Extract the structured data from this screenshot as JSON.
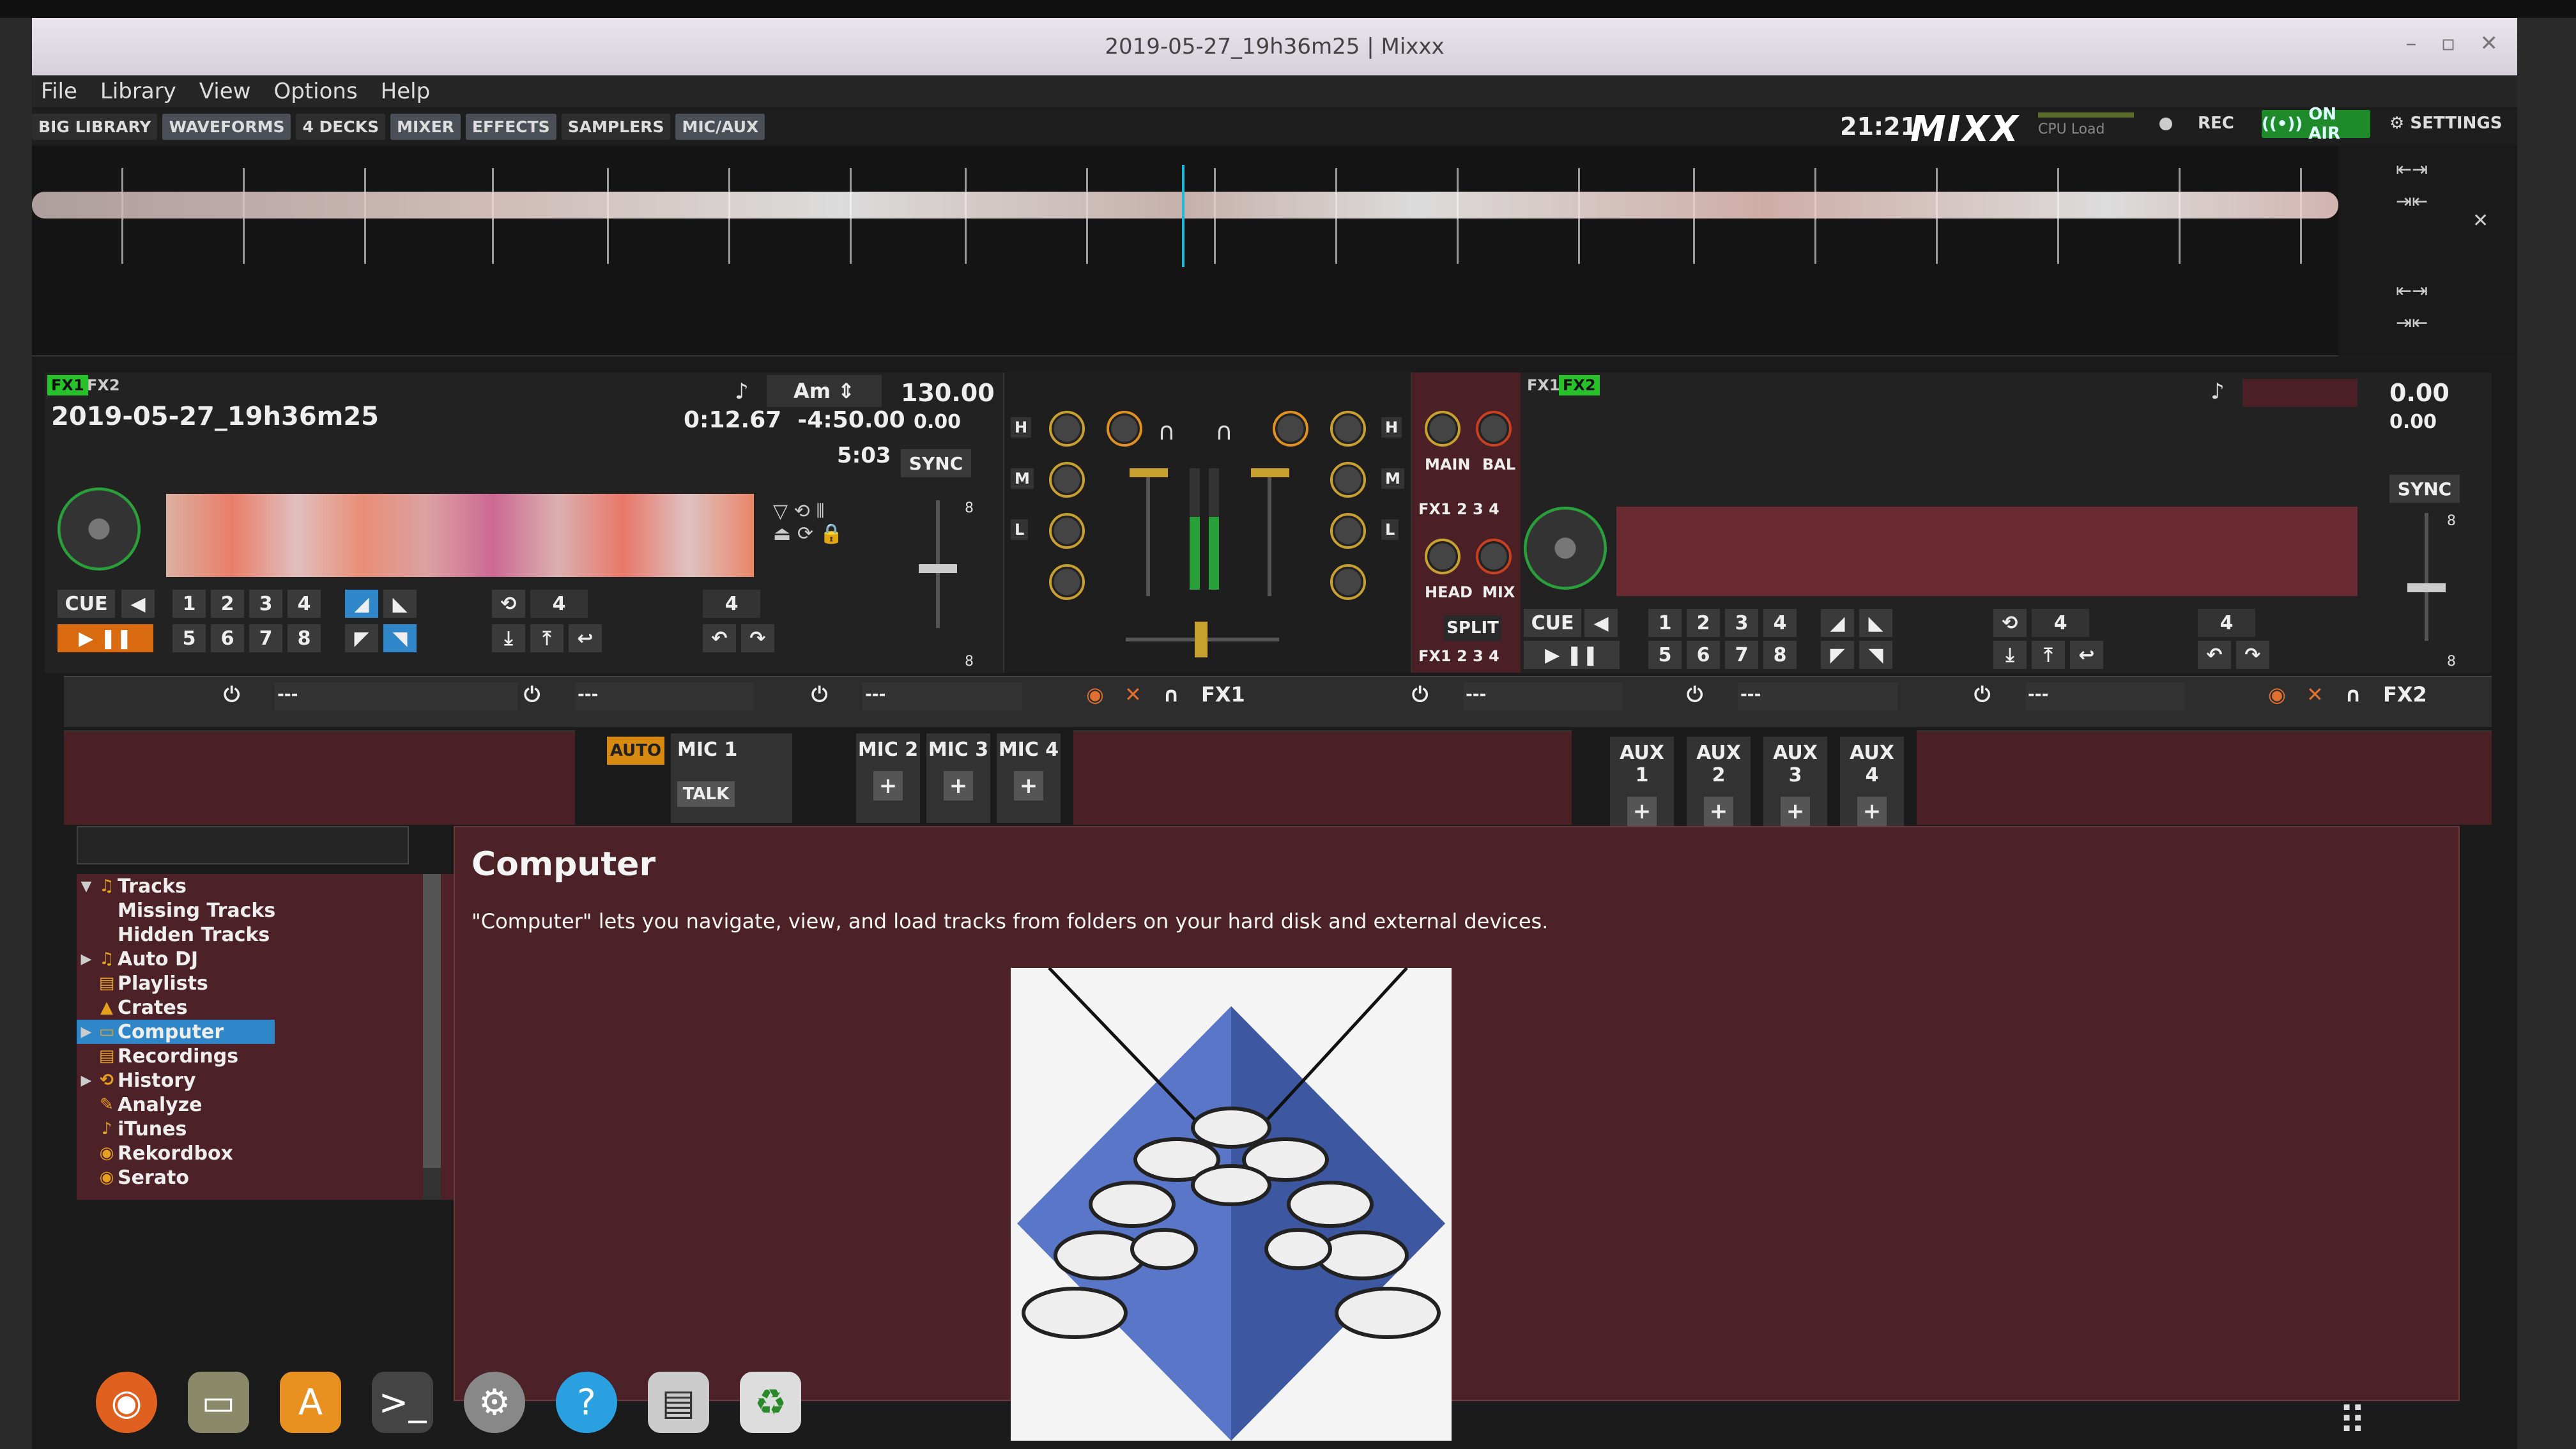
{
  "window": {
    "title": "2019-05-27_19h36m25 | Mixxx"
  },
  "menu": [
    "File",
    "Library",
    "View",
    "Options",
    "Help"
  ],
  "toolbar": {
    "buttons": [
      "BIG LIBRARY",
      "WAVEFORMS",
      "4 DECKS",
      "MIXER",
      "EFFECTS",
      "SAMPLERS",
      "MIC/AUX"
    ],
    "clock": "21:21",
    "logo": "MIXX",
    "cpu_label": "CPU Load",
    "rec": "REC",
    "on_air": "ON AIR",
    "settings": "SETTINGS"
  },
  "deck1": {
    "fx1": "FX1",
    "fx2": "FX2",
    "title": "2019-05-27_19h36m25",
    "position": "0:12.67",
    "remaining": "-4:50.00",
    "duration": "5:03",
    "key": "Am",
    "bpm": "130.00",
    "rate": "0.00",
    "sync": "SYNC",
    "cue": "CUE",
    "play": "▶ ❚❚",
    "hotcues": [
      "1",
      "2",
      "3",
      "4",
      "5",
      "6",
      "7",
      "8"
    ],
    "loop_size": "4",
    "beatjump": "4",
    "rate_scale_top": "8",
    "rate_scale_bottom": "8"
  },
  "deck2": {
    "fx1": "FX1",
    "fx2": "FX2",
    "bpm": "0.00",
    "rate": "0.00",
    "sync": "SYNC",
    "cue": "CUE",
    "play": "▶ ❚❚",
    "hotcues": [
      "1",
      "2",
      "3",
      "4",
      "5",
      "6",
      "7",
      "8"
    ],
    "loop_size": "4",
    "beatjump": "4",
    "rate_scale_top": "8",
    "rate_scale_bottom": "8"
  },
  "mixer": {
    "eq_labels": [
      "H",
      "M",
      "L"
    ],
    "main": "MAIN",
    "bal": "BAL",
    "head": "HEAD",
    "mix": "MIX",
    "split": "SPLIT",
    "fx_assign": [
      "FX1",
      "2",
      "3",
      "4"
    ]
  },
  "effects": {
    "unit1": "FX1",
    "unit2": "FX2",
    "empty": "---"
  },
  "micaux": {
    "auto": "AUTO",
    "talk": "TALK",
    "mics": [
      "MIC 1",
      "MIC 2",
      "MIC 3",
      "MIC 4"
    ],
    "auxes": [
      "AUX 1",
      "AUX 2",
      "AUX 3",
      "AUX 4"
    ],
    "fx": [
      "FX1",
      "FX2"
    ]
  },
  "library": {
    "tree": [
      {
        "label": "Tracks",
        "icon": "♫",
        "expanded": true
      },
      {
        "label": "Missing Tracks",
        "indent": 1
      },
      {
        "label": "Hidden Tracks",
        "indent": 1
      },
      {
        "label": "Auto DJ",
        "icon": "♫"
      },
      {
        "label": "Playlists",
        "icon": "▤"
      },
      {
        "label": "Crates",
        "icon": "▲"
      },
      {
        "label": "Computer",
        "icon": "▭",
        "selected": true
      },
      {
        "label": "Recordings",
        "icon": "▤"
      },
      {
        "label": "History",
        "icon": "⟲"
      },
      {
        "label": "Analyze",
        "icon": "✎"
      },
      {
        "label": "iTunes",
        "icon": "♪"
      },
      {
        "label": "Rekordbox",
        "icon": "◉"
      },
      {
        "label": "Serato",
        "icon": "◉"
      }
    ],
    "heading": "Computer",
    "description": "\"Computer\" lets you navigate, view, and load tracks from folders on your hard disk and external devices."
  },
  "colors": {
    "accent_green": "#27c22a",
    "play_orange": "#d96a10",
    "selection": "#2f86c8",
    "library_bg": "#4c2228"
  }
}
